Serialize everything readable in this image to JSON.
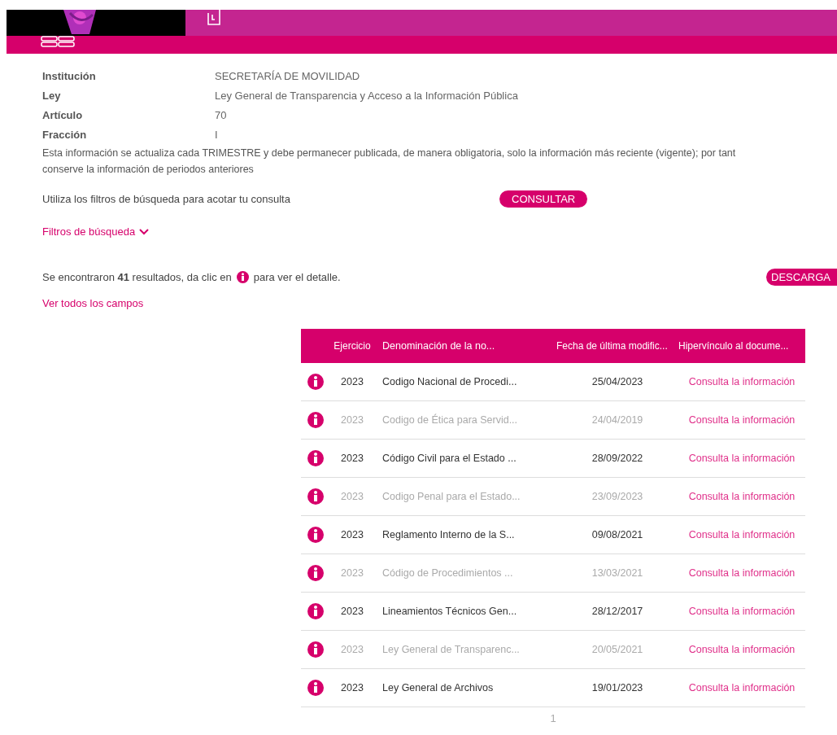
{
  "details": [
    {
      "label": "Institución",
      "value": "SECRETARÍA DE MOVILIDAD"
    },
    {
      "label": "Ley",
      "value": "Ley General de Transparencia y Acceso a la Información Pública"
    },
    {
      "label": "Artículo",
      "value": "70"
    },
    {
      "label": "Fracción",
      "value": "I"
    }
  ],
  "notice": "Esta información se actualiza cada TRIMESTRE y debe permanecer publicada, de manera obligatoria, solo la información más reciente (vigente); por tant\nconserve la información de periodos anteriores",
  "filter_hint": "Utiliza los filtros de búsqueda para acotar tu consulta",
  "consult_button": "CONSULTAR",
  "filters_toggle": {
    "label": "Filtros de búsqueda",
    "expanded": false
  },
  "results_text": "Se encontraron **41** resultados, da clic en",
  "results_suffix": "para ver el detalle.",
  "download_button": "DESCARGA",
  "all_fields_link": "Ver todos los campos",
  "table": {
    "columns": [
      "Ejercicio",
      "Denominación de la no...",
      "Fecha de última modific...",
      "Hipervínculo al docume..."
    ],
    "rows": [
      {
        "year": "2023",
        "name": "Codigo Nacional de Procedi...",
        "date": "25/04/2023",
        "link": "Consulta la información",
        "dimmed": false
      },
      {
        "year": "2023",
        "name": "Codigo de Ética para Servid...",
        "date": "24/04/2019",
        "link": "Consulta la información",
        "dimmed": true
      },
      {
        "year": "2023",
        "name": "Código Civil para el Estado ...",
        "date": "28/09/2022",
        "link": "Consulta la información",
        "dimmed": false
      },
      {
        "year": "2023",
        "name": "Codigo Penal para el Estado...",
        "date": "23/09/2023",
        "link": "Consulta la información",
        "dimmed": true
      },
      {
        "year": "2023",
        "name": "Reglamento Interno de la S...",
        "date": "09/08/2021",
        "link": "Consulta la información",
        "dimmed": false
      },
      {
        "year": "2023",
        "name": "Código de Procedimientos ...",
        "date": "13/03/2021",
        "link": "Consulta la información",
        "dimmed": true
      },
      {
        "year": "2023",
        "name": "Lineamientos Técnicos Gen...",
        "date": "28/12/2017",
        "link": "Consulta la información",
        "dimmed": false
      },
      {
        "year": "2023",
        "name": "Ley General de Transparenc...",
        "date": "20/05/2021",
        "link": "Consulta la información",
        "dimmed": true
      },
      {
        "year": "2023",
        "name": "Ley General de Archivos",
        "date": "19/01/2023",
        "link": "Consulta la información",
        "dimmed": false
      }
    ]
  },
  "pagination": [
    {
      "label": "1",
      "selected": true
    }
  ]
}
